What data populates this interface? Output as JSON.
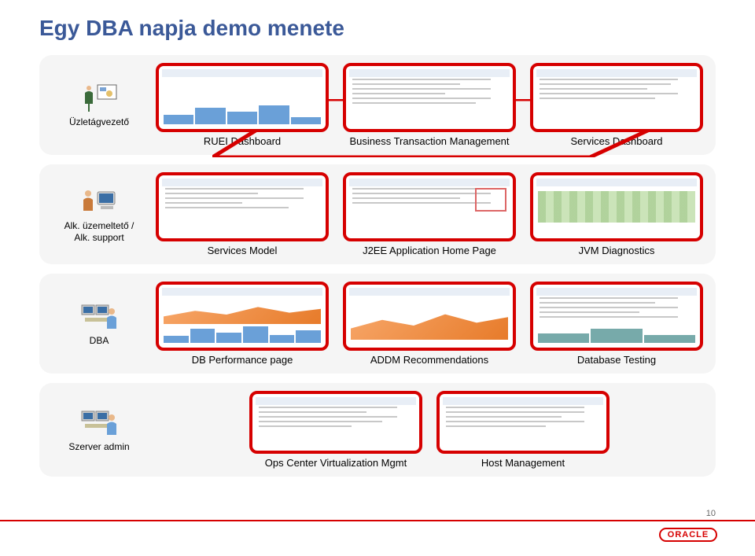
{
  "slide": {
    "title": "Egy DBA napja demo menete",
    "page_number": "10",
    "brand": "ORACLE"
  },
  "rows": [
    {
      "role": "Üzletágvezető",
      "panels": [
        {
          "label": "RUEI Dashboard"
        },
        {
          "label": "Business Transaction Management"
        },
        {
          "label": "Services Dashboard"
        }
      ]
    },
    {
      "role": "Alk. üzemeltető /\nAlk. support",
      "panels": [
        {
          "label": "Services Model"
        },
        {
          "label": "J2EE Application Home Page"
        },
        {
          "label": "JVM Diagnostics"
        }
      ]
    },
    {
      "role": "DBA",
      "panels": [
        {
          "label": "DB Performance page"
        },
        {
          "label": "ADDM Recommendations"
        },
        {
          "label": "Database Testing"
        }
      ]
    },
    {
      "role": "Szerver admin",
      "panels": [
        {
          "label": "Ops Center Virtualization Mgmt"
        },
        {
          "label": "Host Management"
        }
      ]
    }
  ]
}
